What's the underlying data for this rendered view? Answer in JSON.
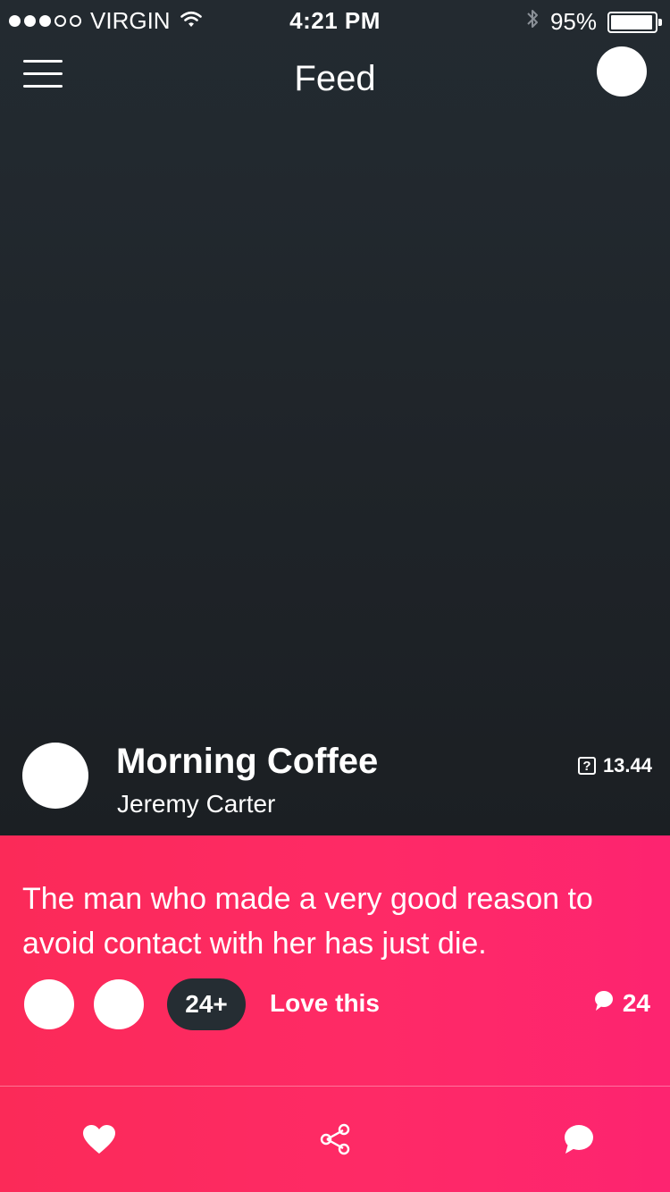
{
  "status_bar": {
    "carrier": "VIRGIN",
    "signal_bars": 3,
    "signal_total": 5,
    "time": "4:21 PM",
    "battery": "95%",
    "battery_level": 0.95,
    "icons": [
      "wifi-icon",
      "bluetooth-icon",
      "battery-icon"
    ]
  },
  "nav": {
    "title": "Feed",
    "menu_icon": "hamburger-menu-icon"
  },
  "post": {
    "title": "Morning Coffee",
    "author": "Jeremy Carter",
    "time": "13.44",
    "time_icon": "?",
    "body": "The man who made a very good reason to avoid contact with her has just die.",
    "likers_count": "24+",
    "love_label": "Love this",
    "comment_count": "24"
  },
  "tabbar": {
    "items": [
      "heart-icon",
      "share-icon",
      "comment-icon"
    ]
  },
  "colors": {
    "accent_pink": "#fe2a66",
    "hero_dark": "#1f2429",
    "pill_dark": "#252d33"
  }
}
